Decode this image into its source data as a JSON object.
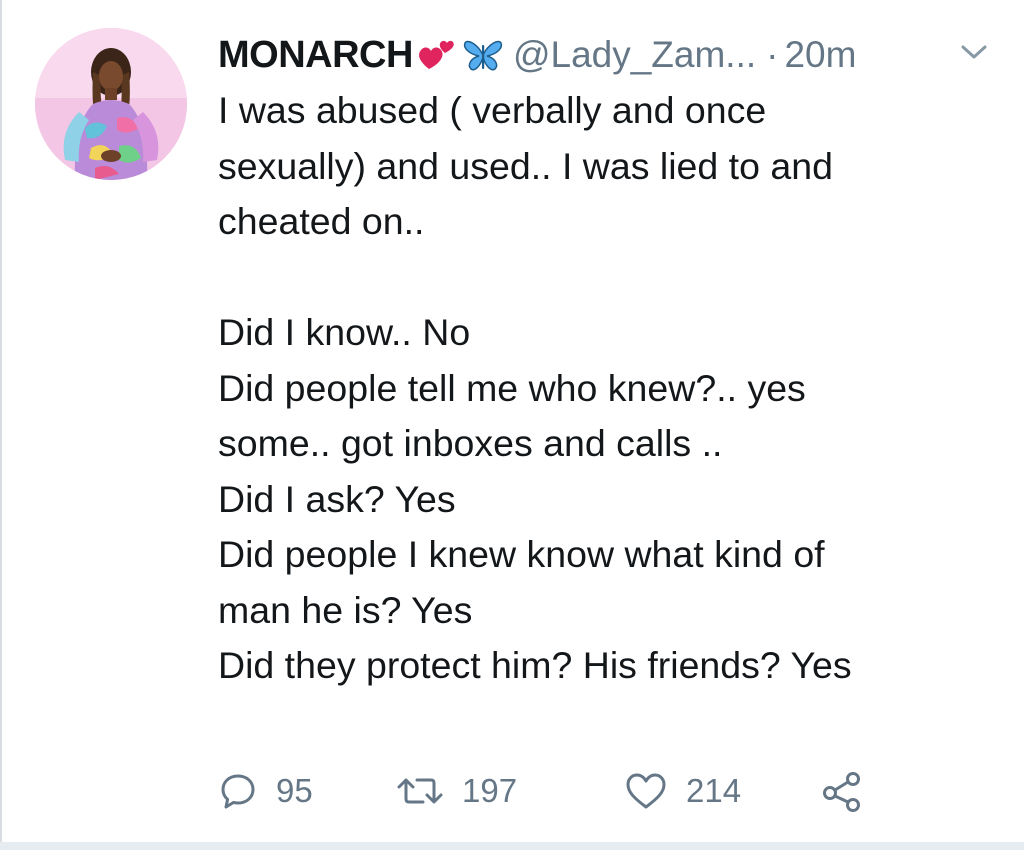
{
  "tweet": {
    "display_name": "MONARCH",
    "handle": "@Lady_Zam...",
    "separator": "·",
    "time": "20m",
    "emoji_icons": [
      "revolving-hearts-icon",
      "butterfly-icon"
    ],
    "body_lines": [
      "I was abused ( verbally and once",
      "sexually) and used.. I was lied to and",
      "cheated on..",
      "",
      "Did I know.. No",
      "Did people tell me who knew?.. yes",
      "some.. got inboxes and calls ..",
      "Did I ask? Yes",
      "Did people I knew know what kind of",
      "man he is? Yes",
      "Did they protect him? His friends? Yes"
    ]
  },
  "actions": {
    "reply_count": "95",
    "retweet_count": "197",
    "like_count": "214"
  },
  "colors": {
    "text": "#14171a",
    "secondary": "#657786",
    "heart": "#e0245e",
    "butterfly": "#55acee"
  }
}
